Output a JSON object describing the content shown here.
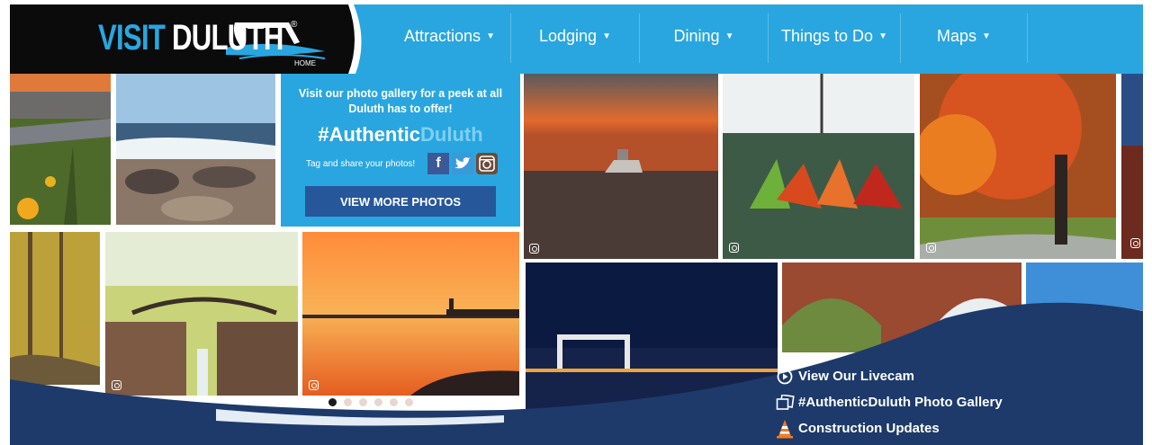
{
  "logo": {
    "word1": "VISIT ",
    "word2": "DULUTH",
    "home": "HOME",
    "reg": "®"
  },
  "nav": [
    {
      "label": "Attractions"
    },
    {
      "label": "Lodging"
    },
    {
      "label": "Dining"
    },
    {
      "label": "Things to Do"
    },
    {
      "label": "Maps"
    }
  ],
  "promo": {
    "lead": "Visit our photo gallery for a peek at all Duluth has to offer!",
    "hashtag_a": "#Authentic",
    "hashtag_b": "Duluth",
    "share": "Tag and share your photos!",
    "social": [
      "facebook-icon",
      "twitter-icon",
      "instagram-icon"
    ],
    "button": "VIEW MORE PHOTOS"
  },
  "links": [
    {
      "label": "View Our Livecam",
      "icon": "play-circle-icon"
    },
    {
      "label": "#AuthenticDuluth Photo Gallery",
      "icon": "photos-icon"
    },
    {
      "label": "Construction Updates",
      "icon": "traffic-cone-icon"
    }
  ],
  "slider": {
    "count": 6,
    "active": 0
  },
  "colors": {
    "brand_blue": "#29a6df",
    "navy": "#1c3a68",
    "button": "#27579b",
    "black": "#0b0b0b"
  }
}
